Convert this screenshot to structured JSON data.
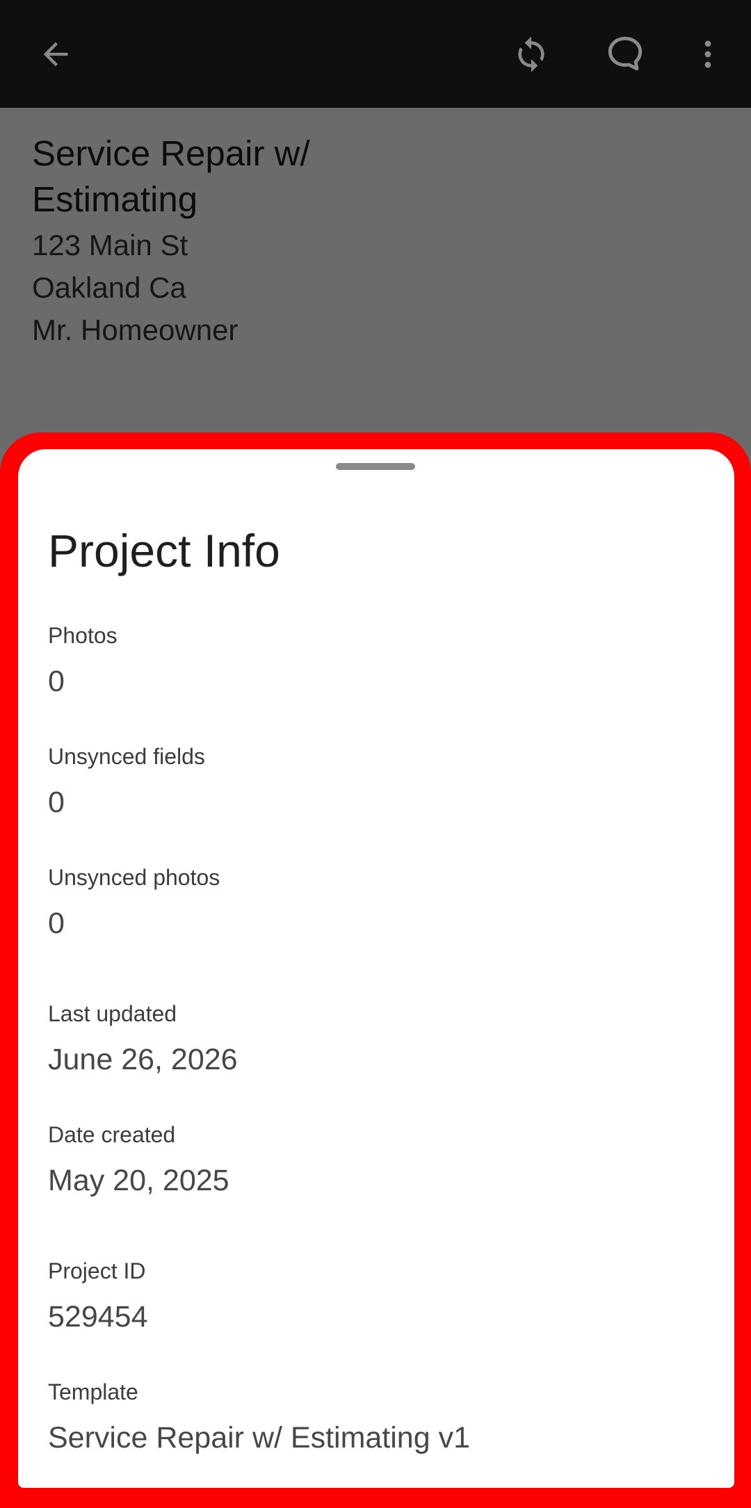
{
  "appbar": {
    "back_icon": "arrow-left-icon",
    "sync_icon": "sync-icon",
    "comment_icon": "comment-icon",
    "more_icon": "more-vert-icon"
  },
  "project": {
    "title": "Service Repair w/ Estimating",
    "address_line1": "123 Main St",
    "address_line2": "Oakland Ca",
    "contact": "Mr. Homeowner"
  },
  "sheet": {
    "title": "Project Info",
    "fields": [
      {
        "label": "Photos",
        "value": "0"
      },
      {
        "label": "Unsynced fields",
        "value": "0"
      },
      {
        "label": "Unsynced photos",
        "value": "0"
      },
      {
        "label": "Last updated",
        "value": "June 26, 2026"
      },
      {
        "label": "Date created",
        "value": "May 20, 2025"
      },
      {
        "label": "Project ID",
        "value": "529454"
      },
      {
        "label": "Template",
        "value": "Service Repair w/ Estimating v1"
      }
    ]
  },
  "colors": {
    "appbar_bg": "#0f0f0f",
    "scrim_bg": "#6b6b6b",
    "highlight": "#ff0000",
    "sheet_bg": "#ffffff"
  }
}
